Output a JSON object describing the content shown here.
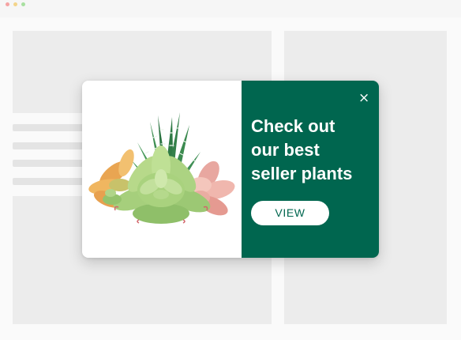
{
  "window": {
    "controls": [
      "close",
      "minimize",
      "maximize"
    ]
  },
  "colors": {
    "panel_bg": "#00664f",
    "button_text": "#00664f",
    "close_icon": "#ffffff"
  },
  "popup": {
    "image": {
      "icon": "succulent-plants-image"
    },
    "close": {
      "label": "×",
      "icon": "close-icon"
    },
    "headline": "Check out\nour best\nseller plants",
    "cta": {
      "label": "VIEW"
    }
  }
}
